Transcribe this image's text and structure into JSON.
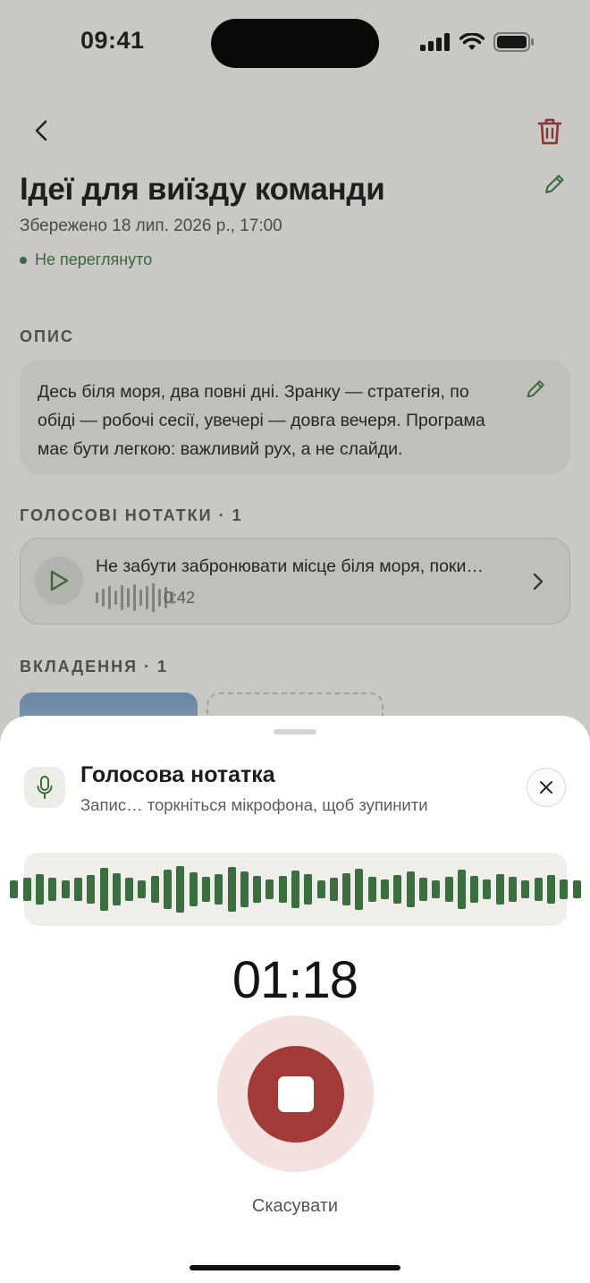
{
  "status_bar": {
    "time": "09:41"
  },
  "header": {
    "back_icon": "chevron-left-icon",
    "delete_icon": "trash-icon",
    "delete_color": "#a23a38"
  },
  "note": {
    "title": "Ідеї для виїзду команди",
    "saved": "Збережено 18 лип. 2026 р., 17:00",
    "status": "Не переглянуто",
    "status_color": "#3e7a45"
  },
  "description": {
    "label": "ОПИС",
    "text": "Десь біля моря, два повні дні. Зранку — стратегія, по обіді — робочі сесії, увечері — довга вечеря. Програма має бути легкою: важливий рух, а не слайди."
  },
  "voice_notes": {
    "label": "ГОЛОСОВІ НОТАТКИ · 1",
    "items": [
      {
        "text": "Не забути забронювати місце біля моря, поки…",
        "duration": "0:42"
      }
    ]
  },
  "attachments": {
    "label": "ВКЛАДЕННЯ · 1"
  },
  "recorder": {
    "title": "Голосова нотатка",
    "subtitle": "Запис… торкніться мікрофона, щоб зупинити",
    "timer": "01:18",
    "cancel_label": "Скасувати",
    "accent_color": "#3b6e3f",
    "stop_color": "#a23a38"
  }
}
